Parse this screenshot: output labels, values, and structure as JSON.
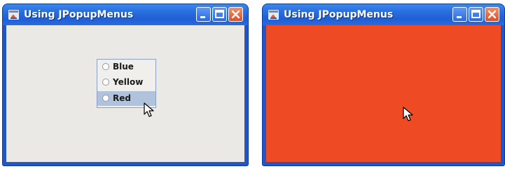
{
  "windows": [
    {
      "title": "Using JPopupMenus",
      "popup_menu": {
        "items": [
          {
            "label": "Blue",
            "selected": false
          },
          {
            "label": "Yellow",
            "selected": false
          },
          {
            "label": "Red",
            "selected": true
          }
        ]
      },
      "background_color": "#ebe9e6"
    },
    {
      "title": "Using JPopupMenus",
      "background_color": "#ee4a23"
    }
  ],
  "icons": {
    "app": "java-app-icon",
    "minimize": "minimize-icon",
    "maximize": "maximize-icon",
    "close": "close-icon",
    "cursor": "mouse-pointer-icon"
  },
  "colors": {
    "titlebar": "#2a6fe0",
    "selection": "#b1c2dc",
    "close_button": "#d8502d"
  }
}
